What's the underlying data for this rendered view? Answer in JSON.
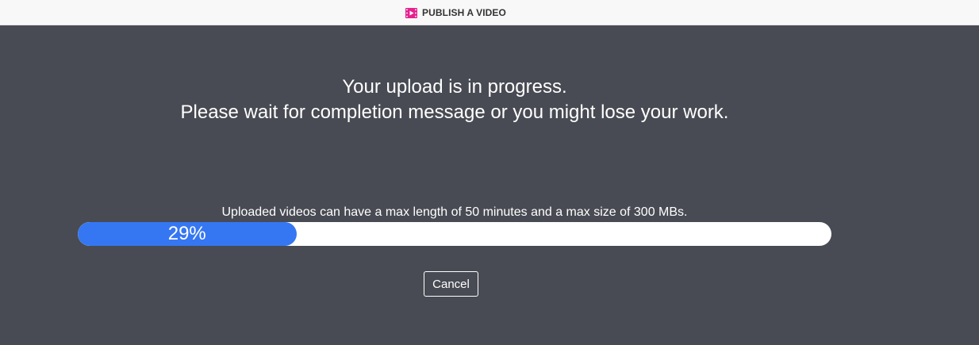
{
  "header": {
    "title": "PUBLISH A VIDEO",
    "icon": "video-icon",
    "icon_color": "#e5208f"
  },
  "upload": {
    "message_line1": "Your upload is in progress.",
    "message_line2": "Please wait for completion message or you might lose your work.",
    "limits_note": "Uploaded videos can have a max length of 50 minutes and a max size of 300 MBs.",
    "progress_percent": 29,
    "progress_label": "29%",
    "cancel_label": "Cancel"
  },
  "colors": {
    "background": "#484b53",
    "progress_fill": "#3577f2",
    "progress_track": "#ffffff",
    "header_background": "#f8f8f8"
  }
}
